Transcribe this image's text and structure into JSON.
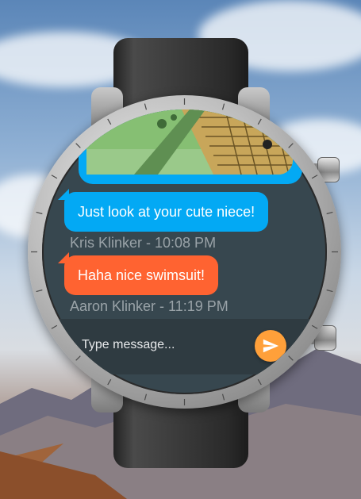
{
  "messages": [
    {
      "type": "image",
      "from": "remote",
      "color": "#03a9f4"
    },
    {
      "text": "Just look at your cute niece!",
      "color": "#03a9f4",
      "meta": "Kris Klinker - 10:08 PM"
    },
    {
      "text": "Haha nice swimsuit!",
      "color": "#ff6331",
      "meta": "Aaron Klinker - 11:19 PM"
    }
  ],
  "composer": {
    "placeholder": "Type message...",
    "value": ""
  },
  "colors": {
    "screen_bg": "#37474f",
    "accent_send": "#ffa03a",
    "bubble_blue": "#03a9f4",
    "bubble_orange": "#ff6331"
  },
  "icons": {
    "send": "send-arrow-icon"
  }
}
